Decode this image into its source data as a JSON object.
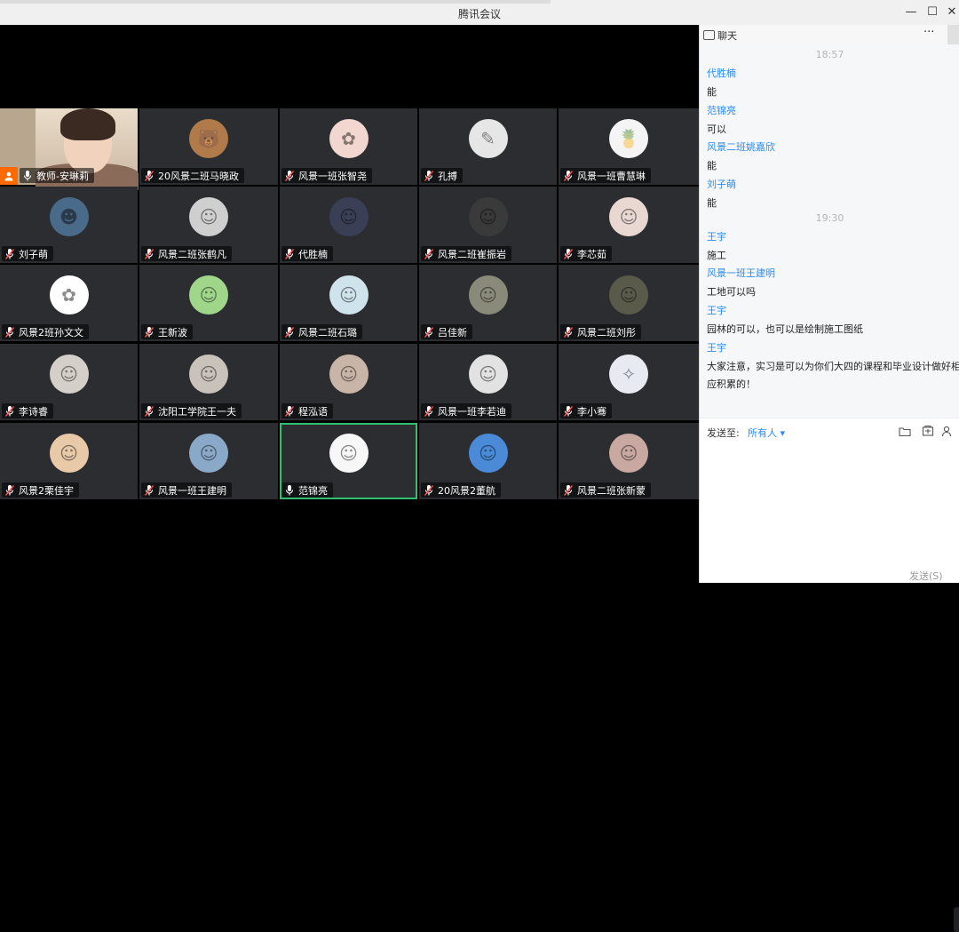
{
  "window": {
    "title": "腾讯会议",
    "minimize": "—",
    "maximize": "☐",
    "close": "✕"
  },
  "participants": [
    {
      "name": "教师-安琳莉",
      "video": true,
      "host": true,
      "avatar_color": "#d8c8b2",
      "avatar_glyph": ""
    },
    {
      "name": "20风景二班马晓政",
      "avatar_color": "#b07a4a",
      "avatar_glyph": "🐻"
    },
    {
      "name": "风景一班张智尧",
      "avatar_color": "#f2d7d0",
      "avatar_glyph": "✿"
    },
    {
      "name": "孔搏",
      "avatar_color": "#e6e6e6",
      "avatar_glyph": "✎"
    },
    {
      "name": "风景一班曹慧琳",
      "avatar_color": "#f4f4f4",
      "avatar_glyph": "🍍"
    },
    {
      "name": "刘子萌",
      "avatar_color": "#4a6a8a",
      "avatar_glyph": "☻"
    },
    {
      "name": "风景二班张鹤凡",
      "avatar_color": "#cfcfcf",
      "avatar_glyph": "☺"
    },
    {
      "name": "代胜楠",
      "avatar_color": "#3b3f55",
      "avatar_glyph": "☺"
    },
    {
      "name": "风景二班崔振岩",
      "avatar_color": "#3a3a3a",
      "avatar_glyph": "☺"
    },
    {
      "name": "李芯茹",
      "avatar_color": "#e9d7d2",
      "avatar_glyph": "☺"
    },
    {
      "name": "风景2班孙文文",
      "avatar_color": "#ffffff",
      "avatar_glyph": "✿"
    },
    {
      "name": "王新波",
      "avatar_color": "#9fd68a",
      "avatar_glyph": "☺"
    },
    {
      "name": "风景二班石璐",
      "avatar_color": "#cfe3ec",
      "avatar_glyph": "☺"
    },
    {
      "name": "吕佳新",
      "avatar_color": "#8a8a7a",
      "avatar_glyph": "☺"
    },
    {
      "name": "风景二班刘彤",
      "avatar_color": "#5a5a4a",
      "avatar_glyph": "☺"
    },
    {
      "name": "李诗睿",
      "avatar_color": "#d4cfc8",
      "avatar_glyph": "☺"
    },
    {
      "name": "沈阳工学院王一夫",
      "avatar_color": "#c9c2bb",
      "avatar_glyph": "☺"
    },
    {
      "name": "程泓语",
      "avatar_color": "#c9b5a8",
      "avatar_glyph": "☺"
    },
    {
      "name": "风景一班李若迪",
      "avatar_color": "#e2e2e2",
      "avatar_glyph": "☺"
    },
    {
      "name": "李小骞",
      "avatar_color": "#e8eaf2",
      "avatar_glyph": "✧"
    },
    {
      "name": "风景2栗佳宇",
      "avatar_color": "#e8c9a8",
      "avatar_glyph": "☺"
    },
    {
      "name": "风景一班王建明",
      "avatar_color": "#8aa9c9",
      "avatar_glyph": "☺"
    },
    {
      "name": "范锦亮",
      "avatar_color": "#f7f7f7",
      "avatar_glyph": "☺",
      "active": true
    },
    {
      "name": "20风景2董航",
      "avatar_color": "#4a8ad6",
      "avatar_glyph": "☺"
    },
    {
      "name": "风景二班张新蒙",
      "avatar_color": "#c8a8a0",
      "avatar_glyph": "☺"
    }
  ],
  "chat": {
    "title": "聊天",
    "more": "···",
    "messages": [
      {
        "type": "time",
        "text": "18:57"
      },
      {
        "type": "sender",
        "text": "代胜楠"
      },
      {
        "type": "msg",
        "text": "能"
      },
      {
        "type": "sender",
        "text": "范锦亮"
      },
      {
        "type": "msg",
        "text": "可以"
      },
      {
        "type": "sender",
        "text": "风景二班姚嘉欣"
      },
      {
        "type": "msg",
        "text": "能"
      },
      {
        "type": "sender",
        "text": "刘子萌"
      },
      {
        "type": "msg",
        "text": "能"
      },
      {
        "type": "time",
        "text": "19:30"
      },
      {
        "type": "sender",
        "text": "王宇"
      },
      {
        "type": "msg",
        "text": "施工"
      },
      {
        "type": "sender",
        "text": "风景一班王建明"
      },
      {
        "type": "msg",
        "text": "工地可以吗"
      },
      {
        "type": "sender",
        "text": "王宇"
      },
      {
        "type": "msg",
        "text": "园林的可以，也可以是绘制施工图纸"
      },
      {
        "type": "sender",
        "text": "王宇"
      },
      {
        "type": "msg",
        "text": "大家注意，实习是可以为你们大四的课程和毕业设计做好相"
      },
      {
        "type": "msg",
        "text": "应积累的！"
      }
    ],
    "send_to_label": "发送至:",
    "send_to_value": "所有人 ▾",
    "send_button": "发送(S)",
    "tool_icons": [
      "folder-icon",
      "screenshot-icon",
      "user-icon"
    ]
  }
}
